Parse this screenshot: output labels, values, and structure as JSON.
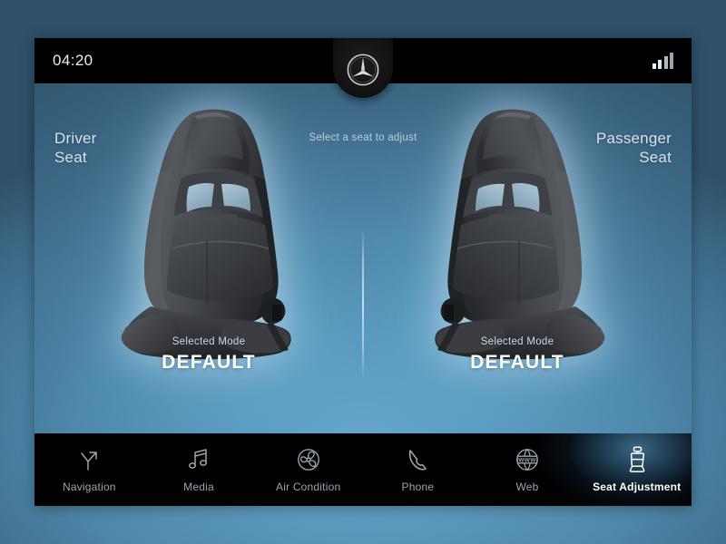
{
  "status_bar": {
    "time": "04:20",
    "brand_logo": "mercedes-benz-star-icon",
    "signal_icon": "signal-bars-icon",
    "signal_bars": 4
  },
  "header": {
    "driver_label_line1": "Driver",
    "driver_label_line2": "Seat",
    "passenger_label_line1": "Passenger",
    "passenger_label_line2": "Seat",
    "hint": "Select a seat to adjust"
  },
  "seats": [
    {
      "position": "driver",
      "image": "car-seat-icon",
      "mode_label": "Selected Mode",
      "mode_value": "DEFAULT"
    },
    {
      "position": "passenger",
      "image": "car-seat-icon",
      "mode_label": "Selected Mode",
      "mode_value": "DEFAULT"
    }
  ],
  "nav": {
    "items": [
      {
        "label": "Navigation",
        "icon": "navigation-fork-icon",
        "active": false
      },
      {
        "label": "Media",
        "icon": "music-note-icon",
        "active": false
      },
      {
        "label": "Air Condition",
        "icon": "fan-icon",
        "active": false
      },
      {
        "label": "Phone",
        "icon": "phone-handset-icon",
        "active": false
      },
      {
        "label": "Web",
        "icon": "globe-www-icon",
        "active": false
      },
      {
        "label": "Seat Adjustment",
        "icon": "car-seat-icon",
        "active": true
      }
    ]
  },
  "colors": {
    "screen_bg_light": "#66a7cb",
    "screen_bg_dark": "#325870",
    "page_frame": "#2b4255",
    "bar_black": "#000000",
    "text_primary": "#ffffff",
    "text_muted": "#cbdbe6",
    "nav_inactive": "#9aa4ac",
    "active_glow": "#5ca8d7"
  }
}
